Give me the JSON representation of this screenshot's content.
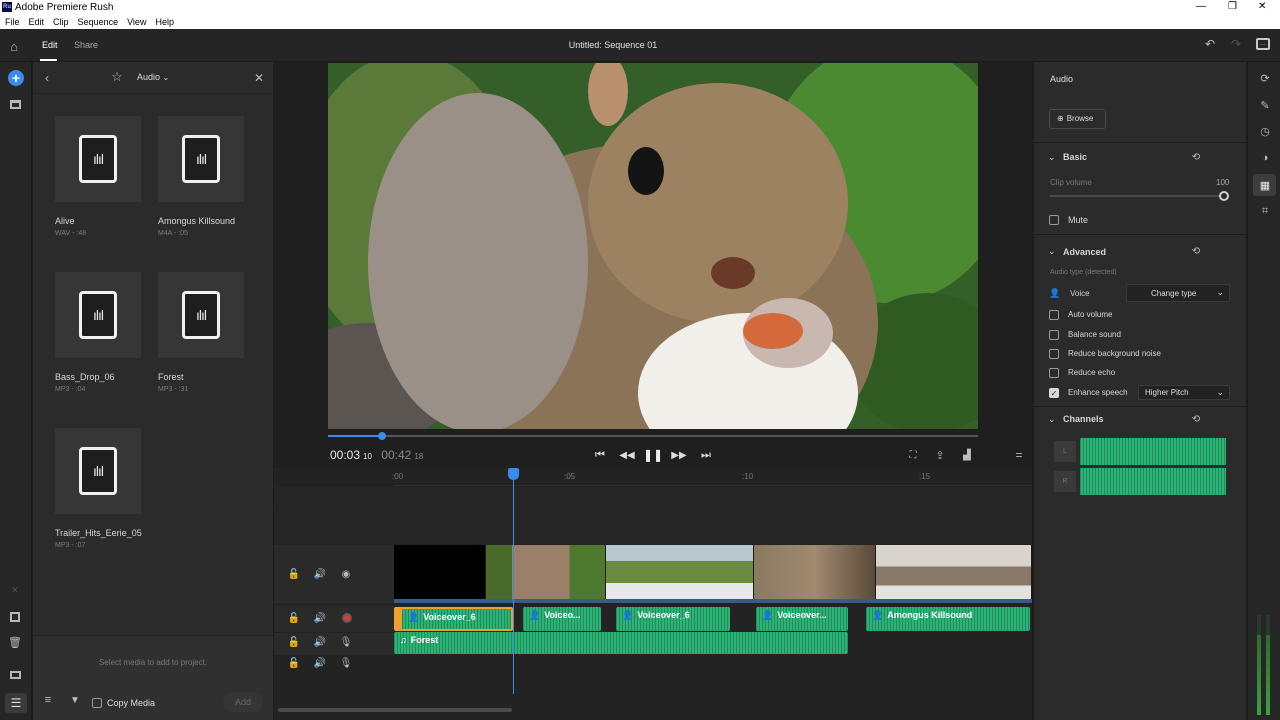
{
  "window": {
    "title": "Adobe Premiere Rush",
    "logo": "Ru",
    "controls": [
      "—",
      "❐",
      "✕"
    ]
  },
  "menu": [
    "File",
    "Edit",
    "Clip",
    "Sequence",
    "View",
    "Help"
  ],
  "appbar": {
    "tabs": [
      "Edit",
      "Share"
    ],
    "sequence_title": "Untitled: Sequence 01"
  },
  "media_panel": {
    "category": "Audio",
    "items": [
      {
        "name": "Alive",
        "meta": "WAV - :48"
      },
      {
        "name": "Amongus Killsound",
        "meta": "M4A - :05"
      },
      {
        "name": "Bass_Drop_06",
        "meta": "MP3 - :04"
      },
      {
        "name": "Forest",
        "meta": "MP3 - :31"
      },
      {
        "name": "Trailer_Hits_Eerie_05",
        "meta": "MP3 - :07"
      }
    ],
    "footer_hint": "Select media to add to project.",
    "copy_media_label": "Copy Media",
    "add_label": "Add"
  },
  "player": {
    "current": "00:03",
    "current_frames": "10",
    "duration": "00:42",
    "duration_frames": "18",
    "progress": 0.082
  },
  "timeline": {
    "ruler": [
      ":00",
      ":05",
      ":10",
      ":15"
    ],
    "video_clips": 5,
    "voice_clips": [
      "Voiceover_6",
      "Voiceo...",
      "Voiceover_6",
      "Voiceover...",
      "Amongus Killsound"
    ],
    "music_clip": "Forest"
  },
  "audio_panel": {
    "title": "Audio",
    "browse_label": "Browse",
    "basic": {
      "header": "Basic",
      "clip_volume_label": "Clip volume",
      "clip_volume_value": "100",
      "mute_label": "Mute"
    },
    "advanced": {
      "header": "Advanced",
      "audio_type_label": "Audio type (detected)",
      "voice_label": "Voice",
      "change_type_label": "Change type",
      "options": [
        {
          "label": "Auto volume",
          "checked": false
        },
        {
          "label": "Balance sound",
          "checked": false
        },
        {
          "label": "Reduce background noise",
          "checked": false
        },
        {
          "label": "Reduce echo",
          "checked": false
        },
        {
          "label": "Enhance speech",
          "checked": true
        }
      ],
      "enhance_speech_value": "Higher Pitch"
    },
    "channels": {
      "header": "Channels",
      "left": "L",
      "right": "R"
    }
  },
  "colors": {
    "accent_blue": "#3b8beb",
    "audio_green": "#2bb376",
    "selected_clip": "#f0a030",
    "record_red": "#e03a3a"
  },
  "icons": [
    "home-icon",
    "plus-icon",
    "media-icon",
    "star-icon",
    "play-icon",
    "pause-icon",
    "gear-icon"
  ]
}
